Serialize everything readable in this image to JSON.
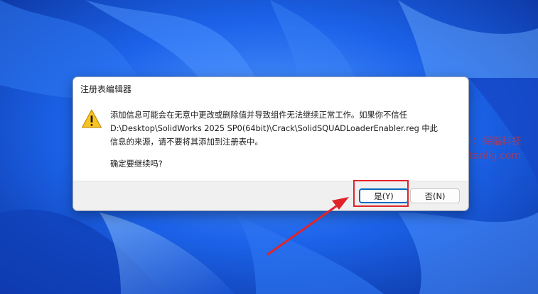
{
  "dialog": {
    "title": "注册表编辑器",
    "icon": "warning-icon",
    "message_lines": [
      "添加信息可能会在无意中更改或删除值并导致组件无法继续正常工作。如果你不信任",
      "D:\\Desktop\\SolidWorks 2025 SP0(64bit)\\Crack\\SolidSQUADLoaderEnabler.reg 中此",
      "信息的来源，请不要将其添加到注册表中。"
    ],
    "confirm": "确定要继续吗?",
    "buttons": {
      "yes": "是(Y)",
      "no": "否(N)"
    }
  },
  "watermark": {
    "line1": "微信公众号：探临科技",
    "line2": "官网：tanlkj.com"
  },
  "colors": {
    "desktop": "#1e63e6",
    "highlight": "#e0242a",
    "accent": "#0067c0"
  }
}
